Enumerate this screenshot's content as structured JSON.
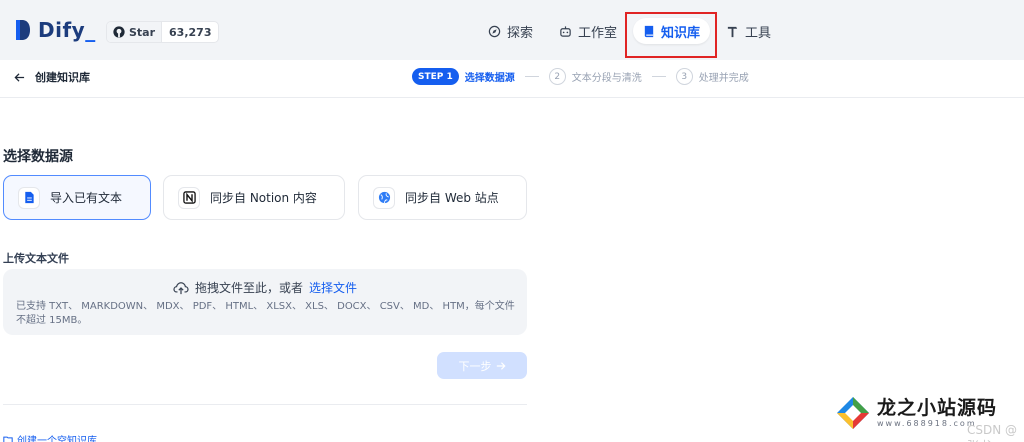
{
  "header": {
    "logo_text": "Dify",
    "logo_suffix": "_",
    "github_star_label": "Star",
    "github_star_count": "63,273",
    "nav": [
      {
        "label": "探索",
        "icon": "compass-icon",
        "active": false
      },
      {
        "label": "工作室",
        "icon": "robot-icon",
        "active": false
      },
      {
        "label": "知识库",
        "icon": "book-icon",
        "active": true
      },
      {
        "label": "工具",
        "icon": "hammer-icon",
        "active": false
      }
    ],
    "highlight_color": "#e02424"
  },
  "subbar": {
    "back_label": "创建知识库",
    "steps": [
      {
        "badge": "STEP 1",
        "label": "选择数据源",
        "active": true
      },
      {
        "badge": "2",
        "label": "文本分段与清洗",
        "active": false
      },
      {
        "badge": "3",
        "label": "处理并完成",
        "active": false
      }
    ]
  },
  "content": {
    "section_title": "选择数据源",
    "sources": [
      {
        "label": "导入已有文本",
        "icon": "file-text-icon",
        "active": true
      },
      {
        "label": "同步自 Notion 内容",
        "icon": "notion-icon",
        "active": false
      },
      {
        "label": "同步自 Web 站点",
        "icon": "web-icon",
        "active": false
      }
    ],
    "upload_label": "上传文本文件",
    "drop_text": "拖拽文件至此，或者",
    "drop_link": "选择文件",
    "drop_hint": "已支持 TXT、 MARKDOWN、 MDX、 PDF、 HTML、 XLSX、 XLS、 DOCX、 CSV、 MD、 HTM，每个文件不超过 15MB。",
    "next_label": "下一步",
    "empty_link": "创建一个空知识库"
  },
  "watermark": {
    "title": "龙之小站源码",
    "sub": "www.688918.com",
    "tail": "CSDN @ 张书"
  },
  "colors": {
    "accent": "#155eef",
    "header_bg": "#f2f4f7",
    "disabled_button": "#d1e0ff"
  }
}
